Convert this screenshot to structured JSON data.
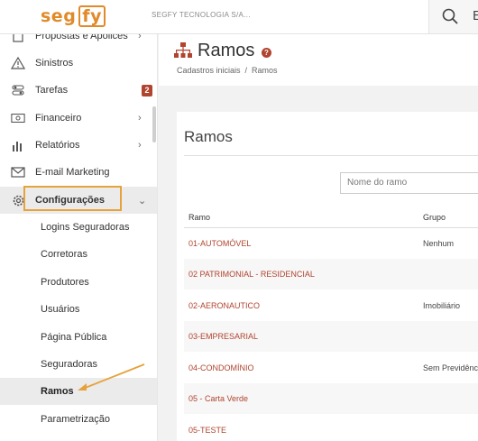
{
  "brand": {
    "logo_left": "seg",
    "logo_right": "fy",
    "company": "SEGFY TECNOLOGIA S/A...",
    "accent": "#e08a2a"
  },
  "topbar": {
    "search_icon": "search-icon",
    "partial_letter": "E"
  },
  "sidebar": {
    "items": [
      {
        "label": "Propostas e Apólices",
        "icon": "document-icon",
        "chevron": "›"
      },
      {
        "label": "Sinistros",
        "icon": "warning-icon"
      },
      {
        "label": "Tarefas",
        "icon": "toggles-icon",
        "badge": "2"
      },
      {
        "label": "Financeiro",
        "icon": "money-icon",
        "chevron": "›"
      },
      {
        "label": "Relatórios",
        "icon": "bar-chart-icon",
        "chevron": "›"
      },
      {
        "label": "E-mail Marketing",
        "icon": "envelope-icon"
      },
      {
        "label": "Configurações",
        "icon": "gear-icon",
        "chevron": "⌄"
      }
    ],
    "subitems": [
      {
        "label": "Logins Seguradoras"
      },
      {
        "label": "Corretoras"
      },
      {
        "label": "Produtores"
      },
      {
        "label": "Usuários"
      },
      {
        "label": "Página Pública"
      },
      {
        "label": "Seguradoras"
      },
      {
        "label": "Ramos",
        "active": true
      },
      {
        "label": "Parametrização"
      }
    ]
  },
  "header": {
    "title": "Ramos",
    "breadcrumb": [
      "Cadastros iniciais",
      "Ramos"
    ]
  },
  "card": {
    "title": "Ramos",
    "search_placeholder": "Nome do ramo",
    "columns": [
      "Ramo",
      "Grupo"
    ],
    "rows": [
      {
        "ramo": "01-AUTOMÓVEL",
        "grupo": "Nenhum"
      },
      {
        "ramo": "02 PATRIMONIAL - RESIDENCIAL",
        "grupo": ""
      },
      {
        "ramo": "02-AERONAUTICO",
        "grupo": "Imobiliário"
      },
      {
        "ramo": "03-EMPRESARIAL",
        "grupo": ""
      },
      {
        "ramo": "04-CONDOMÍNIO",
        "grupo": "Sem Previdência"
      },
      {
        "ramo": "05 - Carta Verde",
        "grupo": ""
      },
      {
        "ramo": "05-TESTE",
        "grupo": ""
      }
    ]
  },
  "colors": {
    "link": "#b0442f",
    "highlight_box": "#e6a23c",
    "badge": "#b0442f"
  }
}
